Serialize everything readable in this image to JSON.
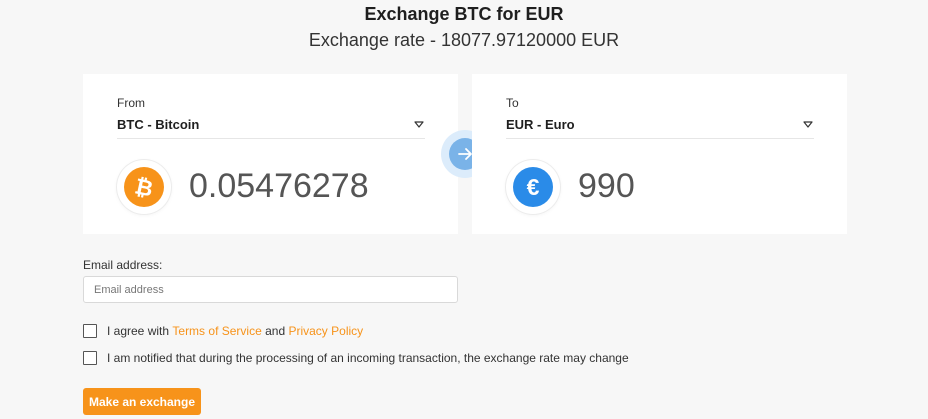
{
  "header": {
    "title": "Exchange BTC for EUR",
    "rate": "Exchange rate - 18077.97120000 EUR"
  },
  "from": {
    "label": "From",
    "selected": "BTC - Bitcoin",
    "amount": "0.05476278",
    "icon": "bitcoin-icon",
    "color": "#f7931a"
  },
  "to": {
    "label": "To",
    "selected": "EUR - Euro",
    "amount": "990",
    "icon": "euro-icon",
    "color": "#2a8be8"
  },
  "swap_icon": "arrow-right-icon",
  "email": {
    "label": "Email address:",
    "placeholder": "Email address",
    "value": ""
  },
  "agreements": {
    "terms_prefix": "I agree with",
    "terms_link": "Terms of Service",
    "and": "and",
    "privacy_link": "Privacy Policy",
    "notice": "I am notified that during the processing of an incoming transaction, the exchange rate may change"
  },
  "submit_label": "Make an exchange",
  "colors": {
    "accent": "#f7931a",
    "swap_button": "#7ab3e8",
    "background": "#f7f7f7"
  }
}
